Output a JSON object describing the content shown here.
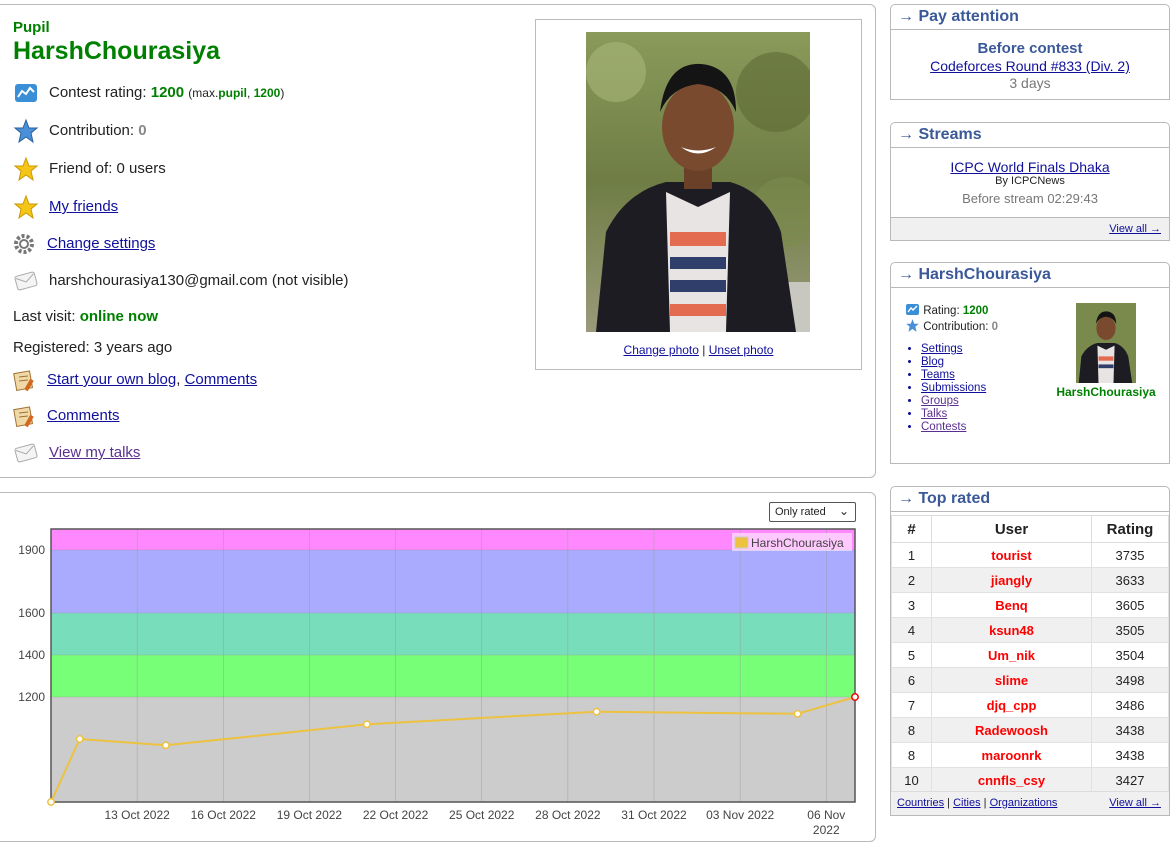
{
  "profile": {
    "rank": "Pupil",
    "handle": "HarshChourasiya",
    "contest_rating_label": "Contest rating:",
    "contest_rating": "1200",
    "max_prefix": "(max.",
    "max_rank": "pupil",
    "max_rating": "1200",
    "contribution_label": "Contribution:",
    "contribution": "0",
    "friend_of": "Friend of: 0 users",
    "my_friends": "My friends",
    "change_settings": "Change settings",
    "email": "harshchourasiya130@gmail.com (not visible)",
    "last_visit_label": "Last visit:",
    "last_visit": "online now",
    "registered": "Registered: 3 years ago",
    "start_blog": "Start your own blog",
    "comments_inline": "Comments",
    "comments": "Comments",
    "view_talks": "View my talks",
    "change_photo": "Change photo",
    "unset_photo": "Unset photo"
  },
  "graph": {
    "filter_selected": "Only rated"
  },
  "chart_data": {
    "type": "line",
    "legend": "HarshChourasiya",
    "legend_position": "top-right",
    "series": [
      {
        "name": "HarshChourasiya",
        "color": "#edc240",
        "points": [
          {
            "x": "2022-10-10",
            "y": 700
          },
          {
            "x": "2022-10-11",
            "y": 1000
          },
          {
            "x": "2022-10-14",
            "y": 970
          },
          {
            "x": "2022-10-21",
            "y": 1070
          },
          {
            "x": "2022-10-29",
            "y": 1130
          },
          {
            "x": "2022-11-05",
            "y": 1120
          },
          {
            "x": "2022-11-07",
            "y": 1200
          }
        ]
      }
    ],
    "y_ticks": [
      "1200",
      "1400",
      "1600",
      "1900"
    ],
    "x_ticks": [
      "13 Oct 2022",
      "16 Oct 2022",
      "19 Oct 2022",
      "22 Oct 2022",
      "25 Oct 2022",
      "28 Oct 2022",
      "31 Oct 2022",
      "03 Nov 2022",
      "06 Nov 2022"
    ],
    "rank_bands": [
      {
        "from": 0,
        "to": 1200,
        "color": "#cccccc"
      },
      {
        "from": 1200,
        "to": 1400,
        "color": "#77ff77"
      },
      {
        "from": 1400,
        "to": 1600,
        "color": "#77ddbb"
      },
      {
        "from": 1600,
        "to": 1900,
        "color": "#aaaaff"
      },
      {
        "from": 1900,
        "to": 2100,
        "color": "#ff88ff"
      }
    ],
    "grid": true
  },
  "sidebar": {
    "pay_attention": {
      "title": "→ Pay attention",
      "subtitle": "Before contest",
      "contest": "Codeforces Round #833 (Div. 2)",
      "time": "3 days"
    },
    "streams": {
      "title": "→ Streams",
      "stream": "ICPC World Finals Dhaka",
      "by": "By ICPCNews",
      "time": "Before stream 02:29:43",
      "view_all": "View all →"
    },
    "user": {
      "title": "→ HarshChourasiya",
      "rating_label": "Rating:",
      "rating": "1200",
      "contribution_label": "Contribution:",
      "contribution": "0",
      "links": [
        "Settings",
        "Blog",
        "Teams",
        "Submissions",
        "Groups",
        "Talks",
        "Contests"
      ],
      "name": "HarshChourasiya"
    },
    "top_rated": {
      "title": "→ Top rated",
      "headers": [
        "#",
        "User",
        "Rating"
      ],
      "rows": [
        {
          "rank": "1",
          "user": "tourist",
          "rating": "3735"
        },
        {
          "rank": "2",
          "user": "jiangly",
          "rating": "3633"
        },
        {
          "rank": "3",
          "user": "Benq",
          "rating": "3605"
        },
        {
          "rank": "4",
          "user": "ksun48",
          "rating": "3505"
        },
        {
          "rank": "5",
          "user": "Um_nik",
          "rating": "3504"
        },
        {
          "rank": "6",
          "user": "slime",
          "rating": "3498"
        },
        {
          "rank": "7",
          "user": "djq_cpp",
          "rating": "3486"
        },
        {
          "rank": "8",
          "user": "Radewoosh",
          "rating": "3438"
        },
        {
          "rank": "8",
          "user": "maroonrk",
          "rating": "3438"
        },
        {
          "rank": "10",
          "user": "cnnfls_csy",
          "rating": "3427"
        }
      ],
      "footer_links": [
        "Countries",
        "Cities",
        "Organizations"
      ],
      "view_all": "View all →"
    }
  }
}
